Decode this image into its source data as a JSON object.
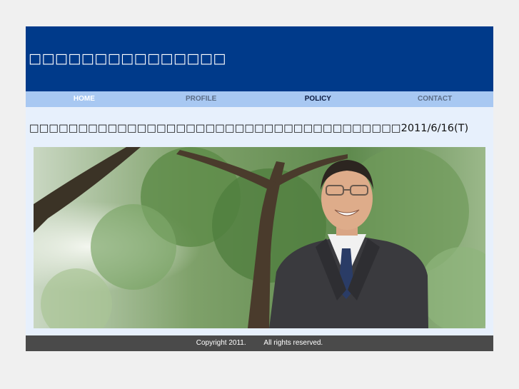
{
  "header": {
    "title": "□□□□□□□□□□□□□□□"
  },
  "nav": {
    "items": [
      {
        "label": "HOME"
      },
      {
        "label": "PROFILE"
      },
      {
        "label": "POLICY"
      },
      {
        "label": "CONTACT"
      }
    ]
  },
  "main": {
    "headline": "□□□□□□□□□□□□□□□□□□□□□□□□□□□□□□□□□□□□□□2011/6/16(T)"
  },
  "footer": {
    "copyright": "Copyright 2011.",
    "rights": "All rights reserved."
  },
  "colors": {
    "header_bg": "#003a8a",
    "nav_bg": "#a8c8f2",
    "content_bg": "#e7f0fc",
    "footer_bg": "#4a4a4a"
  }
}
